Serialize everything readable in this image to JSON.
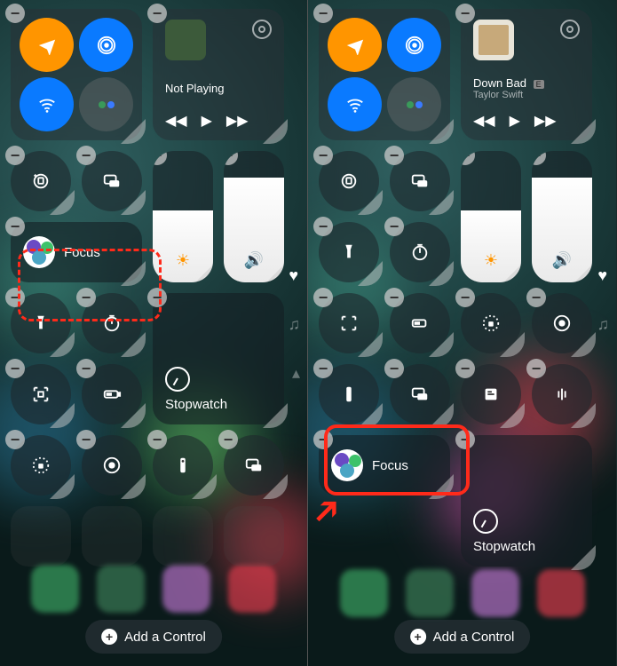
{
  "left": {
    "media": {
      "title": "Not Playing"
    },
    "focus_label": "Focus",
    "stopwatch_label": "Stopwatch",
    "brightness_pct": 55,
    "volume_pct": 80
  },
  "right": {
    "media": {
      "title": "Down Bad",
      "explicit": "E",
      "artist": "Taylor Swift"
    },
    "focus_label": "Focus",
    "stopwatch_label": "Stopwatch",
    "brightness_pct": 55,
    "volume_pct": 80
  },
  "add_label": "Add a Control",
  "annotations": {
    "dashed_target": "focus-tile",
    "solid_target": "focus-tile",
    "arrow_target": "focus-tile"
  }
}
